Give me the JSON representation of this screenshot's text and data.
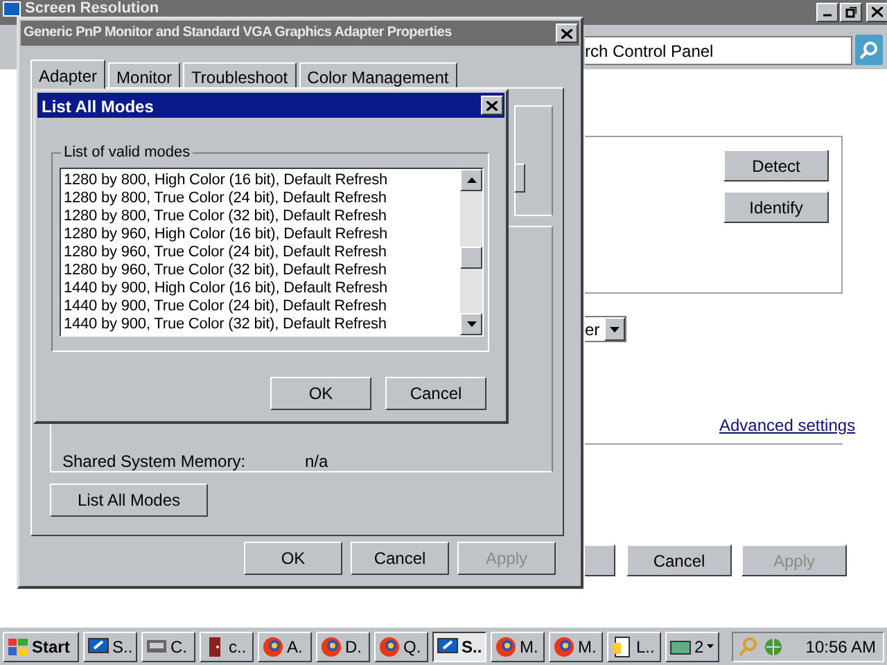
{
  "background_window": {
    "title": "Screen Resolution",
    "address": "rch Control Panel",
    "buttons": [
      "Detect",
      "Identify"
    ],
    "dropdown_value": "er",
    "link": "Advanced settings",
    "footer_buttons": [
      {
        "label": "Cancel",
        "disabled": false
      },
      {
        "label": "Apply",
        "disabled": true
      }
    ]
  },
  "properties_window": {
    "title": "Generic PnP Monitor and Standard VGA Graphics Adapter Properties",
    "tabs": [
      {
        "label": "Adapter",
        "selected": true
      },
      {
        "label": "Monitor",
        "selected": false
      },
      {
        "label": "Troubleshoot",
        "selected": false
      },
      {
        "label": "Color Management",
        "selected": false
      }
    ],
    "info_rows": [
      {
        "label": "Shared System Memory:",
        "value": "n/a"
      }
    ],
    "list_button": "List All Modes",
    "footer_buttons": [
      {
        "label": "OK",
        "disabled": false
      },
      {
        "label": "Cancel",
        "disabled": false
      },
      {
        "label": "Apply",
        "disabled": true
      }
    ]
  },
  "list_dialog": {
    "title": "List All Modes",
    "group_label": "List of valid modes",
    "modes": [
      "1280 by 800, High Color (16 bit), Default Refresh",
      "1280 by 800, True Color (24 bit), Default Refresh",
      "1280 by 800, True Color (32 bit), Default Refresh",
      "1280 by 960, High Color (16 bit), Default Refresh",
      "1280 by 960, True Color (24 bit), Default Refresh",
      "1280 by 960, True Color (32 bit), Default Refresh",
      "1440 by 900, High Color (16 bit), Default Refresh",
      "1440 by 900, True Color (24 bit), Default Refresh",
      "1440 by 900, True Color (32 bit), Default Refresh"
    ],
    "buttons": [
      "OK",
      "Cancel"
    ]
  },
  "taskbar": {
    "start": "Start",
    "items": [
      {
        "label": "S..",
        "kind": "display",
        "selected": false
      },
      {
        "label": "C.",
        "kind": "computer",
        "selected": false
      },
      {
        "label": "c..",
        "kind": "door",
        "selected": false
      },
      {
        "label": "A.",
        "kind": "browser",
        "selected": false
      },
      {
        "label": "D.",
        "kind": "browser",
        "selected": false
      },
      {
        "label": "Q.",
        "kind": "browser",
        "selected": false
      },
      {
        "label": "S..",
        "kind": "display",
        "selected": true
      },
      {
        "label": "M.",
        "kind": "browser",
        "selected": false
      },
      {
        "label": "M.",
        "kind": "browser",
        "selected": false
      },
      {
        "label": "L..",
        "kind": "notepad",
        "selected": false
      },
      {
        "label": "2",
        "kind": "group",
        "selected": false
      }
    ],
    "clock": "10:56 AM"
  }
}
